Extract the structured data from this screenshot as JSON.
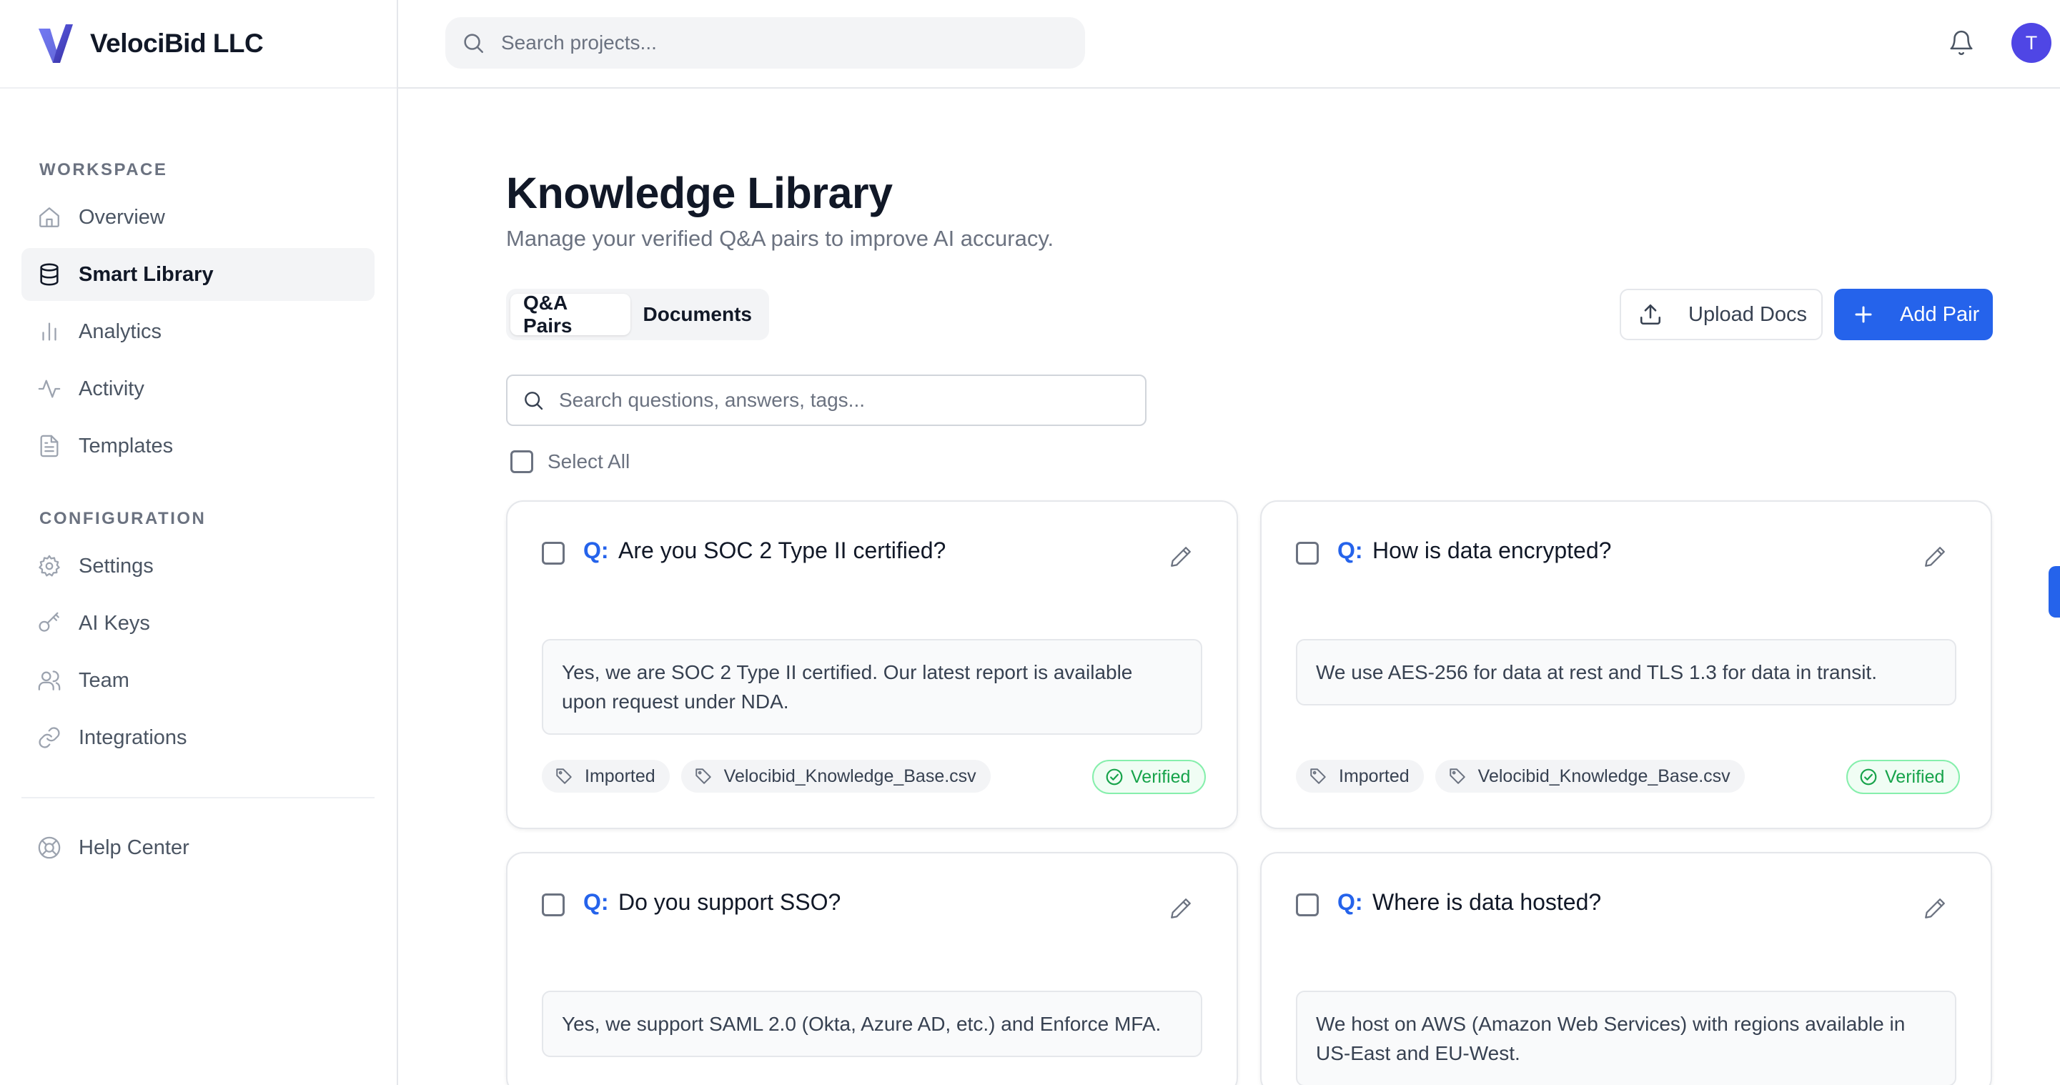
{
  "brand": {
    "name": "VelociBid LLC"
  },
  "topbar": {
    "search_placeholder": "Search projects...",
    "avatar_initial": "T"
  },
  "sidebar": {
    "workspace_label": "WORKSPACE",
    "configuration_label": "CONFIGURATION",
    "workspace_items": [
      {
        "label": "Overview",
        "icon": "home-icon"
      },
      {
        "label": "Smart Library",
        "icon": "database-icon",
        "active": true
      },
      {
        "label": "Analytics",
        "icon": "bar-chart-icon"
      },
      {
        "label": "Activity",
        "icon": "activity-icon"
      },
      {
        "label": "Templates",
        "icon": "file-text-icon"
      }
    ],
    "config_items": [
      {
        "label": "Settings",
        "icon": "gear-icon"
      },
      {
        "label": "AI Keys",
        "icon": "key-icon"
      },
      {
        "label": "Team",
        "icon": "users-icon"
      },
      {
        "label": "Integrations",
        "icon": "link-icon"
      }
    ],
    "help_item": {
      "label": "Help Center",
      "icon": "life-buoy-icon"
    }
  },
  "main": {
    "title": "Knowledge Library",
    "subtitle": "Manage your verified Q&A pairs to improve AI accuracy.",
    "tabs": [
      {
        "label": "Q&A Pairs",
        "active": true
      },
      {
        "label": "Documents",
        "active": false
      }
    ],
    "upload_label": "Upload Docs",
    "add_label": "Add Pair",
    "search_placeholder": "Search questions, answers, tags...",
    "select_all_label": "Select All",
    "q_prefix": "Q:",
    "cards": [
      {
        "question": "Are you SOC 2 Type II certified?",
        "answer": "Yes, we are SOC 2 Type II certified. Our latest report is available upon request under NDA.",
        "tags": [
          "Imported",
          "Velocibid_Knowledge_Base.csv"
        ],
        "status": "Verified"
      },
      {
        "question": "How is data encrypted?",
        "answer": "We use AES-256 for data at rest and TLS 1.3 for data in transit.",
        "tags": [
          "Imported",
          "Velocibid_Knowledge_Base.csv"
        ],
        "status": "Verified"
      },
      {
        "question": "Do you support SSO?",
        "answer": "Yes, we support SAML 2.0 (Okta, Azure AD, etc.) and Enforce MFA."
      },
      {
        "question": "Where is data hosted?",
        "answer": "We host on AWS (Amazon Web Services) with regions available in US-East and EU-West."
      }
    ]
  },
  "colors": {
    "accent": "#2563eb",
    "verified": "#16a34a",
    "avatar": "#4f46e5",
    "logo": "#4f46e5"
  }
}
